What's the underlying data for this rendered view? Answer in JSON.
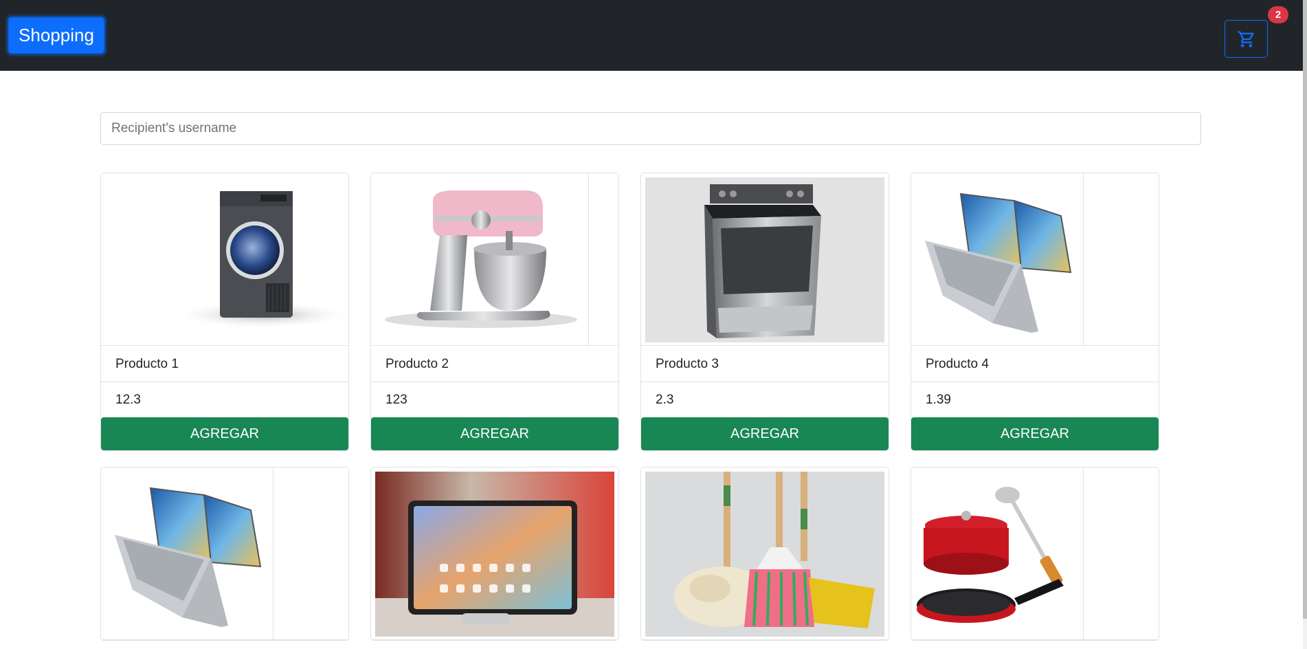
{
  "navbar": {
    "brand_label": "Shopping",
    "cart_icon": "cart-icon",
    "cart_count": "2"
  },
  "search": {
    "placeholder": "Recipient's username",
    "value": ""
  },
  "products": [
    {
      "name": "Producto 1",
      "price": "12.3",
      "button": "AGREGAR",
      "image": "washing-machine"
    },
    {
      "name": "Producto 2",
      "price": "123",
      "button": "AGREGAR",
      "image": "stand-mixer"
    },
    {
      "name": "Producto 3",
      "price": "2.3",
      "button": "AGREGAR",
      "image": "stove-oven"
    },
    {
      "name": "Producto 4",
      "price": "1.39",
      "button": "AGREGAR",
      "image": "convertible-laptop"
    },
    {
      "name": "",
      "price": "",
      "button": "",
      "image": "convertible-laptop"
    },
    {
      "name": "",
      "price": "",
      "button": "",
      "image": "tablet"
    },
    {
      "name": "",
      "price": "",
      "button": "",
      "image": "mop-and-broom"
    },
    {
      "name": "",
      "price": "",
      "button": "",
      "image": "cookware-set"
    }
  ],
  "colors": {
    "navbar_bg": "#212529",
    "brand_blue": "#0d6efd",
    "badge_red": "#dc3545",
    "add_button_green": "#198754"
  }
}
